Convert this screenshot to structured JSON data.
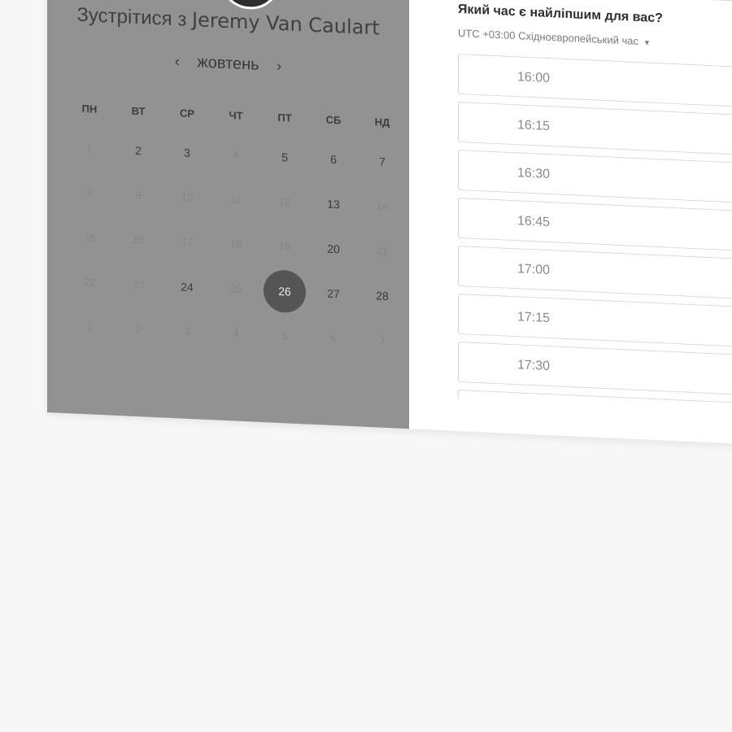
{
  "meeting": {
    "title_prefix": "Зустрітися з",
    "host_name": "Jeremy Van Caulart"
  },
  "calendar": {
    "prev_arrow": "‹",
    "next_arrow": "›",
    "month": "жовтень",
    "weekdays": [
      "ПН",
      "ВТ",
      "СР",
      "ЧТ",
      "ПТ",
      "СБ",
      "НД"
    ],
    "weeks": [
      [
        {
          "d": "1",
          "s": "off"
        },
        {
          "d": "2",
          "s": "on"
        },
        {
          "d": "3",
          "s": "on"
        },
        {
          "d": "4",
          "s": "off"
        },
        {
          "d": "5",
          "s": "on"
        },
        {
          "d": "6",
          "s": "on"
        },
        {
          "d": "7",
          "s": "on"
        }
      ],
      [
        {
          "d": "8",
          "s": "off"
        },
        {
          "d": "9",
          "s": "off"
        },
        {
          "d": "10",
          "s": "off"
        },
        {
          "d": "11",
          "s": "off"
        },
        {
          "d": "12",
          "s": "off"
        },
        {
          "d": "13",
          "s": "on"
        },
        {
          "d": "14",
          "s": "off"
        }
      ],
      [
        {
          "d": "15",
          "s": "off"
        },
        {
          "d": "16",
          "s": "off"
        },
        {
          "d": "17",
          "s": "off"
        },
        {
          "d": "18",
          "s": "off"
        },
        {
          "d": "19",
          "s": "off"
        },
        {
          "d": "20",
          "s": "on"
        },
        {
          "d": "21",
          "s": "off"
        }
      ],
      [
        {
          "d": "22",
          "s": "off"
        },
        {
          "d": "23",
          "s": "off"
        },
        {
          "d": "24",
          "s": "on"
        },
        {
          "d": "25",
          "s": "off"
        },
        {
          "d": "26",
          "s": "sel"
        },
        {
          "d": "27",
          "s": "on"
        },
        {
          "d": "28",
          "s": "on"
        }
      ],
      [
        {
          "d": "1",
          "s": "off"
        },
        {
          "d": "2",
          "s": "off"
        },
        {
          "d": "3",
          "s": "off"
        },
        {
          "d": "4",
          "s": "off"
        },
        {
          "d": "5",
          "s": "off"
        },
        {
          "d": "6",
          "s": "off"
        },
        {
          "d": "7",
          "s": "off"
        }
      ]
    ]
  },
  "times": {
    "question": "Який час є найліпшим для вас?",
    "timezone": "UTC +03:00 Східноєвропейський час",
    "timezone_caret": "▼",
    "slots": [
      "16:00",
      "16:15",
      "16:30",
      "16:45",
      "17:00",
      "17:15",
      "17:30"
    ]
  },
  "colors": {
    "left_panel": "#929292",
    "selected_day": "#555555",
    "right_panel": "#ffffff",
    "page_bg": "#f7f7f7"
  },
  "icons": {
    "avatar": "host-avatar-photo",
    "prev": "chevron-left-icon",
    "next": "chevron-right-icon",
    "tz": "caret-down-icon"
  }
}
